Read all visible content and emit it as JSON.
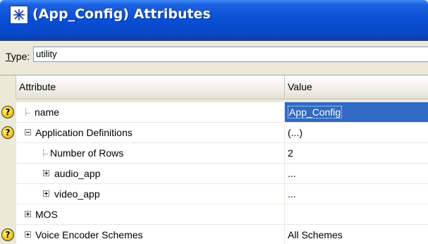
{
  "window": {
    "title": "(App_Config) Attributes",
    "icon": "opnet-star-icon"
  },
  "type_field": {
    "label_mnemonic": "T",
    "label_rest": "ype:",
    "value": "utility"
  },
  "grid": {
    "headers": {
      "attribute": "Attribute",
      "value": "Value"
    },
    "rows": [
      {
        "name": "name",
        "value": "App_Config"
      },
      {
        "name": "Application Definitions",
        "value": "(...)"
      },
      {
        "name": "Number of Rows",
        "value": "2"
      },
      {
        "name": "audio_app",
        "value": "..."
      },
      {
        "name": "video_app",
        "value": "..."
      },
      {
        "name": "MOS",
        "value": ""
      },
      {
        "name": "Voice Encoder Schemes",
        "value": "All Schemes"
      }
    ]
  },
  "colors": {
    "titlebar": "#0a4fd4",
    "selection": "#316ac5",
    "help_icon": "#f4c900"
  }
}
